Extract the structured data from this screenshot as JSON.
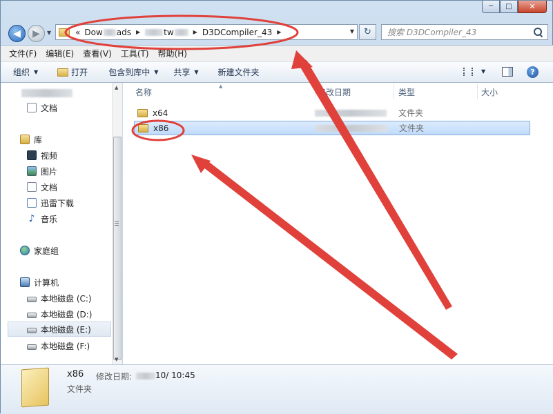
{
  "window": {
    "caption": {
      "minimize": "─",
      "maximize": "□",
      "close": "✕"
    }
  },
  "nav": {
    "back_glyph": "◀",
    "forward_glyph": "▶",
    "crumb_prefix": "«",
    "crumbs": [
      "Dow",
      "ads",
      "tw",
      "D3DCompiler_43"
    ],
    "refresh_glyph": "↻",
    "search_placeholder": "搜索 D3DCompiler_43"
  },
  "menubar": {
    "items": [
      "文件(F)",
      "编辑(E)",
      "查看(V)",
      "工具(T)",
      "帮助(H)"
    ]
  },
  "toolbar": {
    "organize": "组织",
    "open": "打开",
    "include_in_library": "包含到库中",
    "share": "共享",
    "new_folder": "新建文件夹",
    "help_glyph": "?"
  },
  "sidebar": {
    "items": [
      {
        "label": "文档",
        "icon": "document-icon"
      },
      {
        "label": "库",
        "icon": "library-icon"
      },
      {
        "label": "视频",
        "icon": "video-icon"
      },
      {
        "label": "图片",
        "icon": "picture-icon"
      },
      {
        "label": "文档",
        "icon": "document-icon"
      },
      {
        "label": "迅雷下载",
        "icon": "download-icon"
      },
      {
        "label": "音乐",
        "icon": "music-icon"
      },
      {
        "label": "家庭组",
        "icon": "homegroup-icon"
      },
      {
        "label": "计算机",
        "icon": "computer-icon"
      },
      {
        "label": "本地磁盘 (C:)",
        "icon": "drive-icon"
      },
      {
        "label": "本地磁盘 (D:)",
        "icon": "drive-icon"
      },
      {
        "label": "本地磁盘 (E:)",
        "icon": "drive-icon"
      },
      {
        "label": "本地磁盘 (F:)",
        "icon": "drive-icon"
      }
    ]
  },
  "content": {
    "columns": [
      "名称",
      "修改日期",
      "类型",
      "大小"
    ],
    "rows": [
      {
        "name": "x64",
        "type": "文件夹"
      },
      {
        "name": "x86",
        "type": "文件夹"
      }
    ]
  },
  "details": {
    "name": "x86",
    "type": "文件夹",
    "modified_label": "修改日期:",
    "modified_value": "10/   10:45"
  },
  "colors": {
    "annotation": "#e0413a",
    "selection": "#c1dbfc",
    "accent": "#2b6cc0"
  }
}
